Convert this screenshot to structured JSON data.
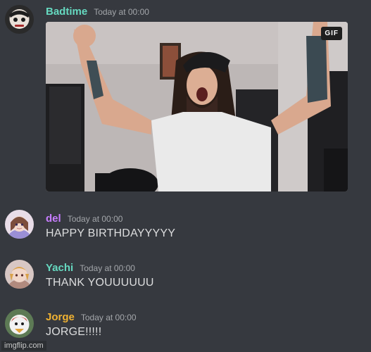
{
  "messages": [
    {
      "username": "Badtime",
      "timestamp": "Today at 00:00",
      "username_color": "#66d9c0",
      "text": ""
    },
    {
      "username": "del",
      "timestamp": "Today at 00:00",
      "username_color": "#c77dff",
      "text": "HAPPY BIRTHDAYYYYY"
    },
    {
      "username": "Yachi",
      "timestamp": "Today at 00:00",
      "username_color": "#66d9c0",
      "text": "THANK YOUUUUUU"
    },
    {
      "username": "Jorge",
      "timestamp": "Today at 00:00",
      "username_color": "#f0b232",
      "text": "JORGE!!!!!"
    }
  ],
  "gif": {
    "badge": "GIF"
  },
  "watermark": "imgflip.com",
  "colors": {
    "background": "#36393f",
    "text": "#dcddde",
    "timestamp": "#a3a6aa"
  }
}
